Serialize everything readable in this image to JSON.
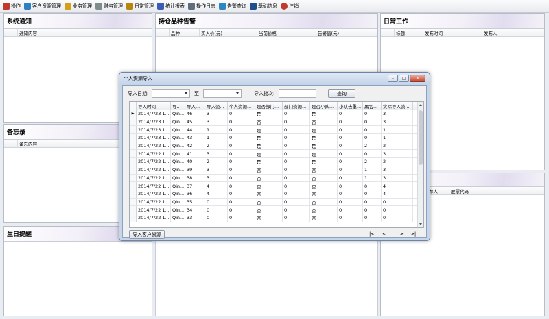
{
  "menu": [
    {
      "label": "操作",
      "icon": "tools-icon",
      "color": "#c0392b"
    },
    {
      "label": "客户资源管理",
      "icon": "customers-icon",
      "color": "#2d7fc1"
    },
    {
      "label": "业务管理",
      "icon": "business-icon",
      "color": "#d4a017"
    },
    {
      "label": "财务管理",
      "icon": "finance-icon",
      "color": "#7f8c8d"
    },
    {
      "label": "日常管理",
      "icon": "daily-icon",
      "color": "#b8860b"
    },
    {
      "label": "统计报表",
      "icon": "report-icon",
      "color": "#3b5bb5"
    },
    {
      "label": "操作日志",
      "icon": "log-icon",
      "color": "#5d6d7e"
    },
    {
      "label": "告警查询",
      "icon": "alarm-icon",
      "color": "#2e86c1"
    },
    {
      "label": "基础信息",
      "icon": "user-icon",
      "color": "#1f4e8c"
    },
    {
      "label": "注销",
      "icon": "logout-icon",
      "color": "#c0392b"
    }
  ],
  "panels": {
    "notice": {
      "title": "系统通知",
      "col": "通知内容"
    },
    "alarm": {
      "title": "持仓品种告警",
      "cols": [
        "品种",
        "买入价(元)",
        "当前价格",
        "告警值(元)"
      ]
    },
    "daily": {
      "title": "日常工作",
      "cols": [
        "标题",
        "发布时间",
        "发布人"
      ]
    },
    "memo": {
      "title": "备忘录",
      "col": "备忘内容"
    },
    "birthday": {
      "title": "生日提醒"
    },
    "lower_right": {
      "cols": [
        "荐人",
        "股票代码"
      ]
    }
  },
  "dialog": {
    "title": "个人资源导入",
    "date_label": "导入日期:",
    "to_label": "至",
    "batch_label": "导入批次:",
    "query_button": "查询",
    "import_button": "导入客户资源",
    "pager": [
      "|<",
      "<",
      ">",
      ">|"
    ],
    "columns": [
      "导入时间",
      "导...",
      "导入...",
      "导入资...",
      "个人资源...",
      "是否部门...",
      "部门资源...",
      "是否小队...",
      "小队去重...",
      "黑名...",
      "实际导入资..."
    ],
    "rows": [
      [
        "2014/7/23 1...",
        "Qin...",
        "46",
        "3",
        "0",
        "是",
        "0",
        "是",
        "0",
        "0",
        "3"
      ],
      [
        "2014/7/23 1...",
        "Qin...",
        "45",
        "3",
        "0",
        "否",
        "0",
        "否",
        "0",
        "0",
        "3"
      ],
      [
        "2014/7/23 1...",
        "Qin...",
        "44",
        "1",
        "0",
        "是",
        "0",
        "是",
        "0",
        "0",
        "1"
      ],
      [
        "2014/7/23 1...",
        "Qin...",
        "43",
        "1",
        "0",
        "是",
        "0",
        "是",
        "0",
        "0",
        "1"
      ],
      [
        "2014/7/22 1...",
        "Qin...",
        "42",
        "2",
        "0",
        "是",
        "0",
        "是",
        "0",
        "2",
        "2"
      ],
      [
        "2014/7/22 1...",
        "Qin...",
        "41",
        "3",
        "0",
        "是",
        "0",
        "是",
        "0",
        "0",
        "3"
      ],
      [
        "2014/7/22 1...",
        "Qin...",
        "40",
        "2",
        "0",
        "是",
        "0",
        "是",
        "0",
        "2",
        "2"
      ],
      [
        "2014/7/22 1...",
        "Qin...",
        "39",
        "3",
        "0",
        "否",
        "0",
        "否",
        "0",
        "1",
        "3"
      ],
      [
        "2014/7/22 1...",
        "Qin...",
        "38",
        "3",
        "0",
        "否",
        "0",
        "否",
        "0",
        "1",
        "3"
      ],
      [
        "2014/7/22 1...",
        "Qin...",
        "37",
        "4",
        "0",
        "否",
        "0",
        "否",
        "0",
        "0",
        "4"
      ],
      [
        "2014/7/22 1...",
        "Qin...",
        "36",
        "4",
        "0",
        "否",
        "0",
        "否",
        "0",
        "0",
        "4"
      ],
      [
        "2014/7/22 1...",
        "Qin...",
        "35",
        "0",
        "0",
        "否",
        "0",
        "否",
        "0",
        "0",
        "0"
      ],
      [
        "2014/7/22 1...",
        "Qin...",
        "34",
        "0",
        "0",
        "否",
        "0",
        "否",
        "0",
        "0",
        "0"
      ],
      [
        "2014/7/22 1...",
        "Qin...",
        "33",
        "0",
        "0",
        "否",
        "0",
        "否",
        "0",
        "0",
        "0"
      ]
    ],
    "current_row_marker": "▶"
  }
}
